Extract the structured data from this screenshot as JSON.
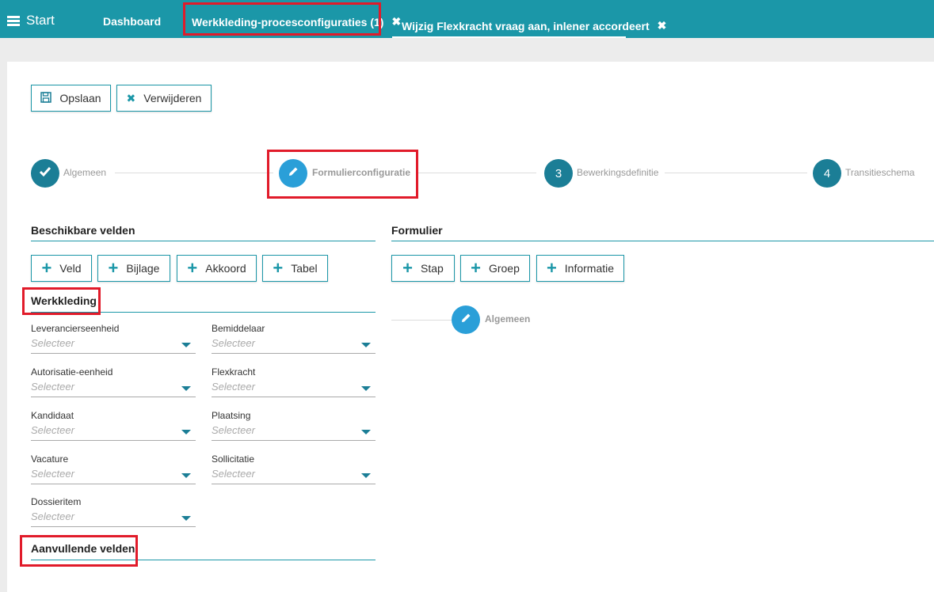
{
  "topbar": {
    "start_label": "Start",
    "tabs": [
      {
        "label": "Dashboard"
      },
      {
        "label": "Werkkleding-procesconfiguraties (1)"
      },
      {
        "label": "Wijzig Flexkracht vraag aan, inlener accordeert"
      }
    ]
  },
  "toolbar": {
    "save_label": "Opslaan",
    "delete_label": "Verwijderen"
  },
  "steps": [
    {
      "label": "Algemeen",
      "status": "done"
    },
    {
      "label": "Formulierconfiguratie",
      "status": "active"
    },
    {
      "number": "3",
      "label": "Bewerkingsdefinitie"
    },
    {
      "number": "4",
      "label": "Transitieschema"
    }
  ],
  "left": {
    "title": "Beschikbare velden",
    "buttons": [
      "Veld",
      "Bijlage",
      "Akkoord",
      "Tabel"
    ],
    "group_title": "Werkkleding",
    "fields": [
      {
        "label": "Leverancierseenheid",
        "placeholder": "Selecteer"
      },
      {
        "label": "Bemiddelaar",
        "placeholder": "Selecteer"
      },
      {
        "label": "Autorisatie-eenheid",
        "placeholder": "Selecteer"
      },
      {
        "label": "Flexkracht",
        "placeholder": "Selecteer"
      },
      {
        "label": "Kandidaat",
        "placeholder": "Selecteer"
      },
      {
        "label": "Plaatsing",
        "placeholder": "Selecteer"
      },
      {
        "label": "Vacature",
        "placeholder": "Selecteer"
      },
      {
        "label": "Sollicitatie",
        "placeholder": "Selecteer"
      },
      {
        "label": "Dossieritem",
        "placeholder": "Selecteer"
      }
    ],
    "extra_title": "Aanvullende velden"
  },
  "right": {
    "title": "Formulier",
    "buttons": [
      "Stap",
      "Groep",
      "Informatie"
    ],
    "step_label": "Algemeen"
  },
  "colors": {
    "accent": "#1b97a8",
    "highlight": "#e11b2a",
    "active_step": "#2a9fd8"
  }
}
